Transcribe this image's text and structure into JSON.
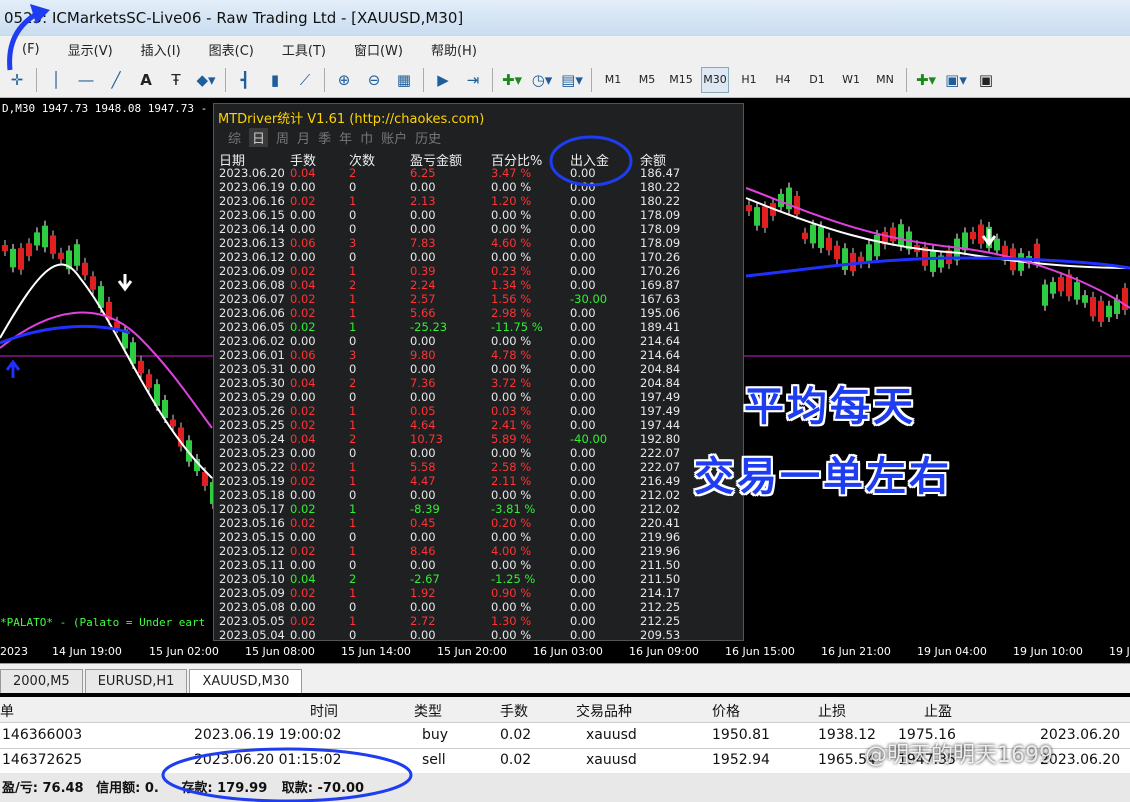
{
  "window": {
    "title": "0525: ICMarketsSC-Live06 - Raw Trading Ltd - [XAUUSD,M30]"
  },
  "menu": [
    "(F)",
    "显示(V)",
    "插入(I)",
    "图表(C)",
    "工具(T)",
    "窗口(W)",
    "帮助(H)"
  ],
  "timeframes": [
    "M1",
    "M5",
    "M15",
    "M30",
    "H1",
    "H4",
    "D1",
    "W1",
    "MN"
  ],
  "active_timeframe": "M30",
  "chart": {
    "symbol_info": "D,M30  1947.73 1948.08 1947.73 -",
    "indicator_text": "*PALATO* - (Palato = Under eart",
    "time_labels": [
      "2023",
      "14 Jun 19:00",
      "15 Jun 02:00",
      "15 Jun 08:00",
      "15 Jun 14:00",
      "15 Jun 20:00",
      "16 Jun 03:00",
      "16 Jun 09:00",
      "16 Jun 15:00",
      "16 Jun 21:00",
      "19 Jun 04:00",
      "19 Jun 10:00",
      "19 J"
    ]
  },
  "overlay": {
    "line1": "平均每天",
    "line2": "交易一单左右",
    "color": "#1f3df0"
  },
  "panel": {
    "title": "MTDriver统计 V1.61 (http://chaokes.com)",
    "tabs": [
      "综",
      "日",
      "周",
      "月",
      "季",
      "年",
      "巾",
      "账户",
      "历史"
    ],
    "active_tab": "日",
    "headers": [
      "日期",
      "手数",
      "次数",
      "盈亏金额",
      "百分比%",
      "出入金",
      "余额"
    ],
    "rows": [
      [
        "2023.06.20",
        "0.04",
        "2",
        "6.25",
        "3.47 %",
        "0.00",
        "186.47",
        "r"
      ],
      [
        "2023.06.19",
        "0.00",
        "0",
        "0.00",
        "0.00 %",
        "0.00",
        "180.22",
        "w"
      ],
      [
        "2023.06.16",
        "0.02",
        "1",
        "2.13",
        "1.20 %",
        "0.00",
        "180.22",
        "r"
      ],
      [
        "2023.06.15",
        "0.00",
        "0",
        "0.00",
        "0.00 %",
        "0.00",
        "178.09",
        "w"
      ],
      [
        "2023.06.14",
        "0.00",
        "0",
        "0.00",
        "0.00 %",
        "0.00",
        "178.09",
        "w"
      ],
      [
        "2023.06.13",
        "0.06",
        "3",
        "7.83",
        "4.60 %",
        "0.00",
        "178.09",
        "r"
      ],
      [
        "2023.06.12",
        "0.00",
        "0",
        "0.00",
        "0.00 %",
        "0.00",
        "170.26",
        "w"
      ],
      [
        "2023.06.09",
        "0.02",
        "1",
        "0.39",
        "0.23 %",
        "0.00",
        "170.26",
        "r"
      ],
      [
        "2023.06.08",
        "0.04",
        "2",
        "2.24",
        "1.34 %",
        "0.00",
        "169.87",
        "r"
      ],
      [
        "2023.06.07",
        "0.02",
        "1",
        "2.57",
        "1.56 %",
        "-30.00",
        "167.63",
        "r"
      ],
      [
        "2023.06.06",
        "0.02",
        "1",
        "5.66",
        "2.98 %",
        "0.00",
        "195.06",
        "r"
      ],
      [
        "2023.06.05",
        "0.02",
        "1",
        "-25.23",
        "-11.75 %",
        "0.00",
        "189.41",
        "g"
      ],
      [
        "2023.06.02",
        "0.00",
        "0",
        "0.00",
        "0.00 %",
        "0.00",
        "214.64",
        "w"
      ],
      [
        "2023.06.01",
        "0.06",
        "3",
        "9.80",
        "4.78 %",
        "0.00",
        "214.64",
        "r"
      ],
      [
        "2023.05.31",
        "0.00",
        "0",
        "0.00",
        "0.00 %",
        "0.00",
        "204.84",
        "w"
      ],
      [
        "2023.05.30",
        "0.04",
        "2",
        "7.36",
        "3.72 %",
        "0.00",
        "204.84",
        "r"
      ],
      [
        "2023.05.29",
        "0.00",
        "0",
        "0.00",
        "0.00 %",
        "0.00",
        "197.49",
        "w"
      ],
      [
        "2023.05.26",
        "0.02",
        "1",
        "0.05",
        "0.03 %",
        "0.00",
        "197.49",
        "r"
      ],
      [
        "2023.05.25",
        "0.02",
        "1",
        "4.64",
        "2.41 %",
        "0.00",
        "197.44",
        "r"
      ],
      [
        "2023.05.24",
        "0.04",
        "2",
        "10.73",
        "5.89 %",
        "-40.00",
        "192.80",
        "r"
      ],
      [
        "2023.05.23",
        "0.00",
        "0",
        "0.00",
        "0.00 %",
        "0.00",
        "222.07",
        "w"
      ],
      [
        "2023.05.22",
        "0.02",
        "1",
        "5.58",
        "2.58 %",
        "0.00",
        "222.07",
        "r"
      ],
      [
        "2023.05.19",
        "0.02",
        "1",
        "4.47",
        "2.11 %",
        "0.00",
        "216.49",
        "r"
      ],
      [
        "2023.05.18",
        "0.00",
        "0",
        "0.00",
        "0.00 %",
        "0.00",
        "212.02",
        "w"
      ],
      [
        "2023.05.17",
        "0.02",
        "1",
        "-8.39",
        "-3.81 %",
        "0.00",
        "212.02",
        "g"
      ],
      [
        "2023.05.16",
        "0.02",
        "1",
        "0.45",
        "0.20 %",
        "0.00",
        "220.41",
        "r"
      ],
      [
        "2023.05.15",
        "0.00",
        "0",
        "0.00",
        "0.00 %",
        "0.00",
        "219.96",
        "w"
      ],
      [
        "2023.05.12",
        "0.02",
        "1",
        "8.46",
        "4.00 %",
        "0.00",
        "219.96",
        "r"
      ],
      [
        "2023.05.11",
        "0.00",
        "0",
        "0.00",
        "0.00 %",
        "0.00",
        "211.50",
        "w"
      ],
      [
        "2023.05.10",
        "0.04",
        "2",
        "-2.67",
        "-1.25 %",
        "0.00",
        "211.50",
        "g"
      ],
      [
        "2023.05.09",
        "0.02",
        "1",
        "1.92",
        "0.90 %",
        "0.00",
        "214.17",
        "r"
      ],
      [
        "2023.05.08",
        "0.00",
        "0",
        "0.00",
        "0.00 %",
        "0.00",
        "212.25",
        "w"
      ],
      [
        "2023.05.05",
        "0.02",
        "1",
        "2.72",
        "1.30 %",
        "0.00",
        "212.25",
        "r"
      ],
      [
        "2023.05.04",
        "0.00",
        "0",
        "0.00",
        "0.00 %",
        "0.00",
        "209.53",
        "w"
      ]
    ]
  },
  "chart_tabs": [
    "2000,M5",
    "EURUSD,H1",
    "XAUUSD,M30"
  ],
  "active_chart_tab": "XAUUSD,M30",
  "trades": {
    "headers": [
      "单",
      "时间",
      "类型",
      "手数",
      "交易品种",
      "价格",
      "止损",
      "止盈",
      ""
    ],
    "rows": [
      [
        "146366003",
        "2023.06.19 19:00:02",
        "buy",
        "0.02",
        "xauusd",
        "1950.81",
        "1938.12",
        "1975.16",
        "2023.06.20"
      ],
      [
        "146372625",
        "2023.06.20 01:15:02",
        "sell",
        "0.02",
        "xauusd",
        "1952.94",
        "1965.54",
        "1947.35",
        "2023.06.20"
      ]
    ],
    "summary": {
      "pl": "盈/亏: 76.48",
      "credit": "信用额: 0.",
      "deposit": "存款: 179.99",
      "withdraw": "取款: -70.00"
    }
  },
  "watermark": "@明天的明天1699",
  "colors": {
    "profit": "#ff3333",
    "loss": "#33ee33",
    "neutral": "#e8e8e8",
    "accent": "#1f3df0"
  }
}
